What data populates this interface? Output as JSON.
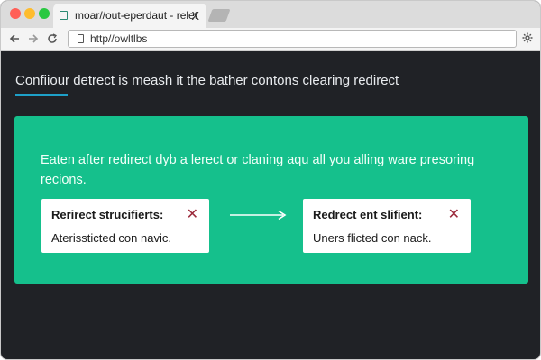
{
  "browser": {
    "tab_title": "moar//out-eperdaut - relet",
    "tab_close": "X",
    "url": "http//owltlbs",
    "controls": {
      "close_color": "#ff5f57",
      "minimize_color": "#febc2e",
      "maximize_color": "#28c840"
    },
    "icons": {
      "back": "arrow-left-icon",
      "forward": "arrow-right-icon",
      "reload": "reload-icon",
      "lock": "lock-icon",
      "extension": "gear-icon"
    }
  },
  "page": {
    "heading": "Confiiour detrect is meash it the bather contons clearing redirect",
    "accent_color": "#1ea0c8",
    "panel": {
      "background": "#15c08c",
      "description": "Eaten after redirect dyb a lerect or claning aqu all you alling ware presoring recions.",
      "cards": [
        {
          "title": "Rerirect strucifierts:",
          "text": "Aterissticted con navic.",
          "close_color": "#9c2b3c"
        },
        {
          "title": "Redrect ent slifient:",
          "text": "Uners flicted con nack.",
          "close_color": "#9c2b3c"
        }
      ],
      "connector": "arrow-right-icon"
    }
  }
}
